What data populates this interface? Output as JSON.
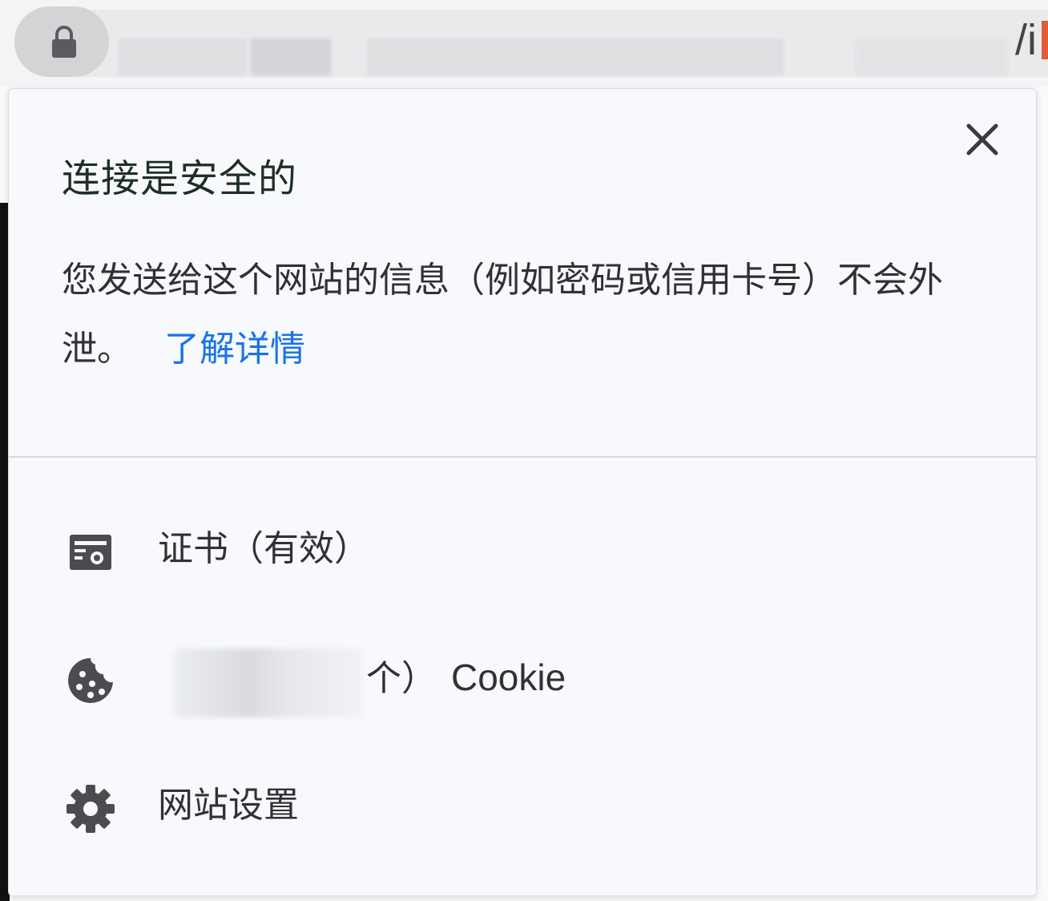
{
  "address_bar": {
    "url_visible_tail": "/i",
    "lock_icon": "lock-icon"
  },
  "popup": {
    "title": "连接是安全的",
    "description": "您发送给这个网站的信息（例如密码或信用卡号）不会外泄。",
    "learn_more_link": "了解详情",
    "close_icon": "close-icon",
    "items": [
      {
        "icon": "certificate-icon",
        "label": "证书（有效）"
      },
      {
        "icon": "cookie-icon",
        "label_suffix": "个）",
        "label_cookie": "Cookie"
      },
      {
        "icon": "gear-icon",
        "label": "网站设置"
      }
    ]
  },
  "colors": {
    "link": "#1a73e8",
    "title": "#1f2f25",
    "text": "#303134",
    "icon": "#4a4c50"
  }
}
